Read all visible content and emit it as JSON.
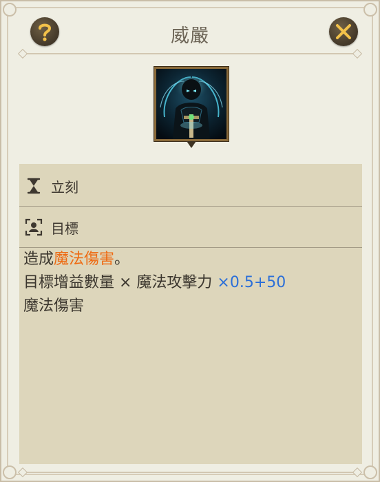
{
  "header": {
    "title": "威嚴",
    "help_icon": "question-mark-icon",
    "close_icon": "close-x-icon"
  },
  "skill": {
    "icon": "dark-armored-figure-skill-icon"
  },
  "info": {
    "cast_time_icon": "hourglass-icon",
    "cast_time_label": "立刻",
    "target_icon": "target-person-icon",
    "target_label": "目標"
  },
  "description": {
    "line1_prefix": "造成",
    "line1_highlight": "魔法傷害",
    "line1_suffix": "。",
    "line2_text": "目標增益數量 × 魔法攻擊力 ",
    "line2_value": "×0.5+50",
    "line3_text": "魔法傷害"
  },
  "colors": {
    "highlight_orange": "#ee6a12",
    "highlight_blue": "#2b6fd8",
    "button_brown": "#4a3e2c",
    "button_gold": "#f2c14a"
  }
}
